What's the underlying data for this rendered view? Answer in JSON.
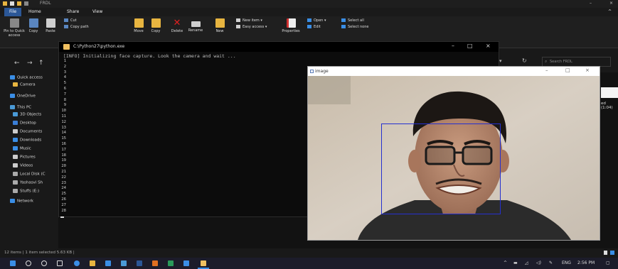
{
  "explorer": {
    "title": "FRDL",
    "tabs": [
      "File",
      "Home",
      "Share",
      "View"
    ],
    "ribbon": {
      "pin_label": "Pin to Quick access",
      "copy_label": "Copy",
      "paste_label": "Paste",
      "cut_label": "Cut",
      "copy_path_label": "Copy path",
      "move_label": "Move",
      "copy_to_label": "Copy",
      "delete_label": "Delete",
      "rename_label": "Rename",
      "new_label": "New",
      "new_item_label": "New item",
      "easy_access_label": "Easy access",
      "properties_label": "Properties",
      "open_label": "Open",
      "edit_label": "Edit",
      "select_all_label": "Select all",
      "select_none_label": "Select none"
    },
    "search_placeholder": "Search FRDL",
    "nav_items": [
      {
        "label": "Quick access",
        "icon": "star-icon",
        "color": "#3a8ee6"
      },
      {
        "label": "Camera",
        "icon": "folder-icon",
        "color": "#e8b540"
      },
      {
        "label": "OneDrive",
        "icon": "cloud-icon",
        "color": "#3a8ee6"
      },
      {
        "label": "This PC",
        "icon": "pc-icon",
        "color": "#4a9ad6"
      },
      {
        "label": "3D Objects",
        "icon": "cube-icon",
        "color": "#4a9ad6"
      },
      {
        "label": "Desktop",
        "icon": "desktop-icon",
        "color": "#3a7ed6"
      },
      {
        "label": "Documents",
        "icon": "document-icon",
        "color": "#cccccc"
      },
      {
        "label": "Downloads",
        "icon": "download-icon",
        "color": "#3a8ee6"
      },
      {
        "label": "Music",
        "icon": "music-icon",
        "color": "#3a8ee6"
      },
      {
        "label": "Pictures",
        "icon": "picture-icon",
        "color": "#cccccc"
      },
      {
        "label": "Videos",
        "icon": "video-icon",
        "color": "#cccccc"
      },
      {
        "label": "Local Disk (C",
        "icon": "drive-icon",
        "color": "#aaaaaa"
      },
      {
        "label": "Yashasvi Sh",
        "icon": "drive-icon",
        "color": "#aaaaaa"
      },
      {
        "label": "Stuffs (E:)",
        "icon": "drive-icon",
        "color": "#aaaaaa"
      },
      {
        "label": "Network",
        "icon": "network-icon",
        "color": "#3a8ee6"
      }
    ],
    "status": "12 items  |  1 item selected  5.63 KB  |",
    "right_edge_text": "ed (1:04)"
  },
  "console": {
    "title": "C:\\Python27\\python.exe",
    "message": "[INFO] Initializing face capture. Look the camera and wait ...",
    "line_numbers": [
      "1",
      "2",
      "3",
      "4",
      "5",
      "6",
      "7",
      "8",
      "9",
      "10",
      "11",
      "12",
      "13",
      "14",
      "15",
      "16",
      "17",
      "18",
      "19",
      "20",
      "21",
      "22",
      "23",
      "24",
      "25",
      "26",
      "27",
      "28"
    ]
  },
  "image_window": {
    "title": "image"
  },
  "taskbar": {
    "lang": "ENG",
    "time": "2:56 PM"
  },
  "colors": {
    "accent": "#2b5797",
    "face_box": "#2530d0"
  }
}
